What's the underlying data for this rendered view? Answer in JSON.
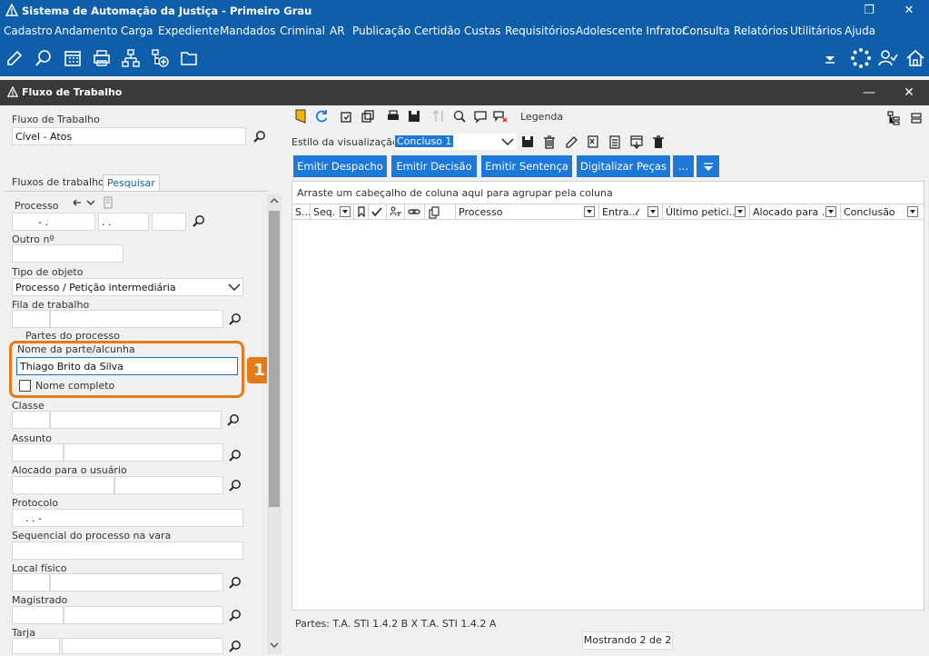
{
  "window": {
    "title": "Sistema de Automação da Justiça - Primeiro Grau",
    "restore_glyph": "❐",
    "close_glyph": "✕"
  },
  "menu": [
    "Cadastro",
    "Andamento",
    "Carga",
    "Expediente",
    "Mandados",
    "Criminal",
    "AR",
    "Publicação",
    "Certidão",
    "Custas",
    "Requisitórios",
    "Adolescente Infrator",
    "Consulta",
    "Relatórios",
    "Utilitários",
    "Ajuda"
  ],
  "subwindow": {
    "title": "Fluxo de Trabalho",
    "minimize_glyph": "—",
    "close_glyph": "✕"
  },
  "left": {
    "fluxo_label": "Fluxo de Trabalho",
    "fluxo_value": "Cível - Atos",
    "tabs": [
      "Fluxos de trabalho",
      "Pesquisar"
    ],
    "processo_label": "Processo",
    "processo_part1": "- .",
    "processo_part2": ". .",
    "outro_label": "Outro nº",
    "tipo_label": "Tipo de objeto",
    "tipo_value": "Processo / Petição intermediária",
    "fila_label": "Fila de trabalho",
    "partes_label": "Partes do processo",
    "nome_parte_label": "Nome da parte/alcunha",
    "nome_parte_value": "Thiago Brito da Silva",
    "nome_completo_label": "Nome completo",
    "highlight_badge": "1",
    "classe_label": "Classe",
    "assunto_label": "Assunto",
    "alocado_label": "Alocado para o usuário",
    "protocolo_label": "Protocolo",
    "protocolo_value": ". . -",
    "sequencial_label": "Sequencial do processo na vara",
    "local_label": "Local físico",
    "magistrado_label": "Magistrado",
    "tarja_label": "Tarja"
  },
  "right": {
    "legenda_label": "Legenda",
    "estilo_label": "Estilo da visualização",
    "estilo_value": "Concluso 1",
    "buttons": [
      "Emitir Despacho",
      "Emitir Decisão",
      "Emitir Sentença",
      "Digitalizar Peças",
      "..."
    ],
    "group_hint": "Arraste um cabeçalho de coluna aqui para agrupar pela coluna",
    "columns": [
      "S...",
      "Seq.",
      "Processo",
      "Entra...",
      "Último petici...",
      "Alocado para ...",
      "Conclusão"
    ],
    "footer_parts": "Partes: T.A. STI 1.4.2 B  X  T.A. STI 1.4.2 A",
    "footer_count": "Mostrando 2 de 2"
  }
}
